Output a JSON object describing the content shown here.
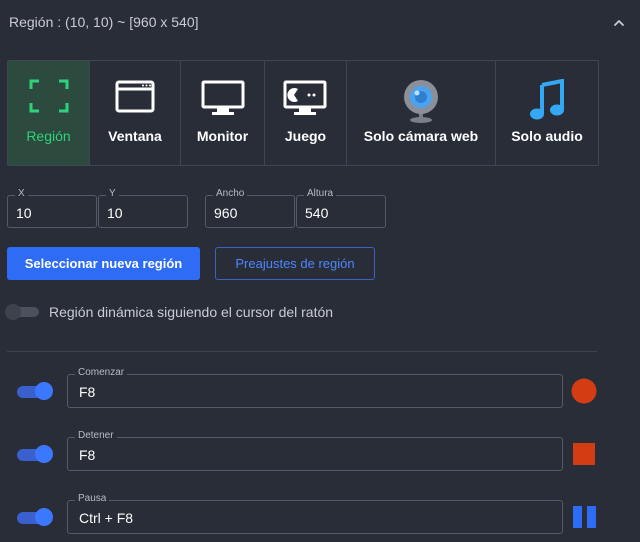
{
  "header": {
    "title": "Región : (10, 10) ~ [960 x 540]"
  },
  "modes": [
    {
      "label": "Región",
      "icon": "region-select-icon"
    },
    {
      "label": "Ventana",
      "icon": "window-icon"
    },
    {
      "label": "Monitor",
      "icon": "monitor-icon"
    },
    {
      "label": "Juego",
      "icon": "gamepad-icon"
    },
    {
      "label": "Solo cámara web",
      "icon": "webcam-icon"
    },
    {
      "label": "Solo audio",
      "icon": "music-note-icon"
    }
  ],
  "coords": {
    "x": {
      "label": "X",
      "value": "10"
    },
    "y": {
      "label": "Y",
      "value": "10"
    },
    "width": {
      "label": "Ancho",
      "value": "960"
    },
    "height": {
      "label": "Altura",
      "value": "540"
    }
  },
  "buttons": {
    "select_region": "Seleccionar nueva región",
    "presets": "Preajustes de región"
  },
  "dynamic_region": {
    "label": "Región dinámica siguiendo el cursor del ratón",
    "enabled": false
  },
  "hotkeys": [
    {
      "label": "Comenzar",
      "value": "F8",
      "enabled": true,
      "icon": "record-icon"
    },
    {
      "label": "Detener",
      "value": "F8",
      "enabled": true,
      "icon": "stop-icon"
    },
    {
      "label": "Pausa",
      "value": "Ctrl + F8",
      "enabled": true,
      "icon": "pause-icon"
    }
  ],
  "colors": {
    "background": "#292d37",
    "accent_blue": "#2f6cf6",
    "active_green": "#2fd27a",
    "record_red": "#d43c14",
    "webcam_blue": "#4aa3f0"
  }
}
